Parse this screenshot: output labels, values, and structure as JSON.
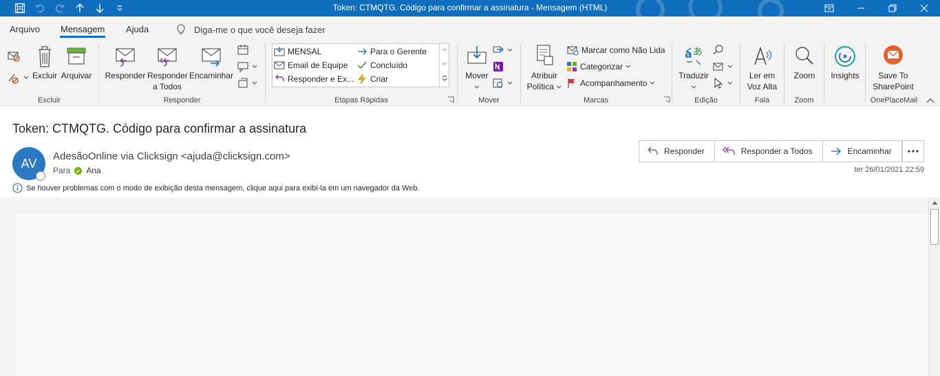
{
  "window": {
    "title": "Token: CTMQTG. Código para confirmar a assinatura  -  Mensagem (HTML)"
  },
  "tabs": [
    {
      "label": "Arquivo"
    },
    {
      "label": "Mensagem"
    },
    {
      "label": "Ajuda"
    }
  ],
  "active_tab": "Mensagem",
  "tell_me": {
    "placeholder": "Diga-me o que você deseja fazer"
  },
  "ribbon": {
    "excluir": {
      "group": "Excluir",
      "delete": "Excluir",
      "archive": "Arquivar"
    },
    "responder": {
      "group": "Responder",
      "reply": "Responder",
      "reply_all_1": "Responder",
      "reply_all_2": "a Todos",
      "forward": "Encaminhar"
    },
    "quick_steps": {
      "group": "Etapas Rápidas",
      "items": [
        "MENSAL",
        "Email de Equipe",
        "Responder e Ex...",
        "Para o Gerente",
        "Concluído",
        "Criar"
      ]
    },
    "mover": {
      "group": "Mover",
      "move": "Mover"
    },
    "marcas": {
      "group": "Marcas",
      "policy_1": "Atribuir",
      "policy_2": "Política",
      "unread": "Marcar como Não Lida",
      "categorize": "Categorizar",
      "follow_up": "Acompanhamento"
    },
    "edicao": {
      "group": "Edição",
      "translate": "Traduzir"
    },
    "fala": {
      "group": "Fala",
      "read_aloud_1": "Ler em",
      "read_aloud_2": "Voz Alta"
    },
    "zoom": {
      "group": "Zoom",
      "zoom": "Zoom"
    },
    "insights": {
      "label": "Insights"
    },
    "oneplacemail": {
      "group": "OnePlaceMail",
      "save_1": "Save To",
      "save_2": "SharePoint"
    }
  },
  "message": {
    "subject": "Token: CTMQTG. Código para confirmar a assinatura",
    "avatar_initials": "AV",
    "sender": "AdesãoOnline via Clicksign <ajuda@clicksign.com>",
    "to_label": "Para",
    "recipient": "Ana",
    "info": "Se houver problemas com o modo de exibição desta mensagem, clique aqui para exibi-la em um navegador da Web.",
    "datetime": "ter 26/01/2021 22:59",
    "actions": {
      "reply": "Responder",
      "reply_all": "Responder a Todos",
      "forward": "Encaminhar"
    }
  },
  "colors": {
    "titlebar": "#106ebe",
    "accent": "#106ebe",
    "avatar": "#2b79c2",
    "ribbon_bg": "#f3f3f3",
    "presence_ok": "#6bb700"
  }
}
